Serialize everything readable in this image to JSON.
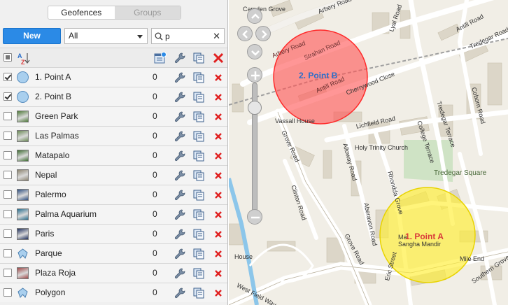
{
  "tabs": [
    {
      "label": "Geofences",
      "active": true
    },
    {
      "label": "Groups",
      "active": false
    }
  ],
  "toolbar": {
    "new_label": "New",
    "filter_value": "All",
    "search_value": "p",
    "clear_glyph": "✕"
  },
  "list_header": {
    "select_all_state": "partial",
    "sort_icon": "sort-az-icon",
    "icons": [
      "layer-settings-icon",
      "wrench-icon",
      "copy-icon",
      "delete-icon"
    ]
  },
  "geofences": [
    {
      "name": "1. Point A",
      "count": "0",
      "checked": true,
      "icon": "circle-icon",
      "thumb": ""
    },
    {
      "name": "2. Point B",
      "count": "0",
      "checked": true,
      "icon": "circle-icon",
      "thumb": ""
    },
    {
      "name": "Green Park",
      "count": "0",
      "checked": false,
      "icon": "photo-icon",
      "thumb": "#4f7a3a"
    },
    {
      "name": "Las Palmas",
      "count": "0",
      "checked": false,
      "icon": "photo-icon",
      "thumb": "#6b8a55"
    },
    {
      "name": "Matapalo",
      "count": "0",
      "checked": false,
      "icon": "photo-icon",
      "thumb": "#3f6d33"
    },
    {
      "name": "Nepal",
      "count": "0",
      "checked": false,
      "icon": "photo-icon",
      "thumb": "#8c8470"
    },
    {
      "name": "Palermo",
      "count": "0",
      "checked": false,
      "icon": "photo-icon",
      "thumb": "#2f4f80"
    },
    {
      "name": "Palma Aquarium",
      "count": "0",
      "checked": false,
      "icon": "photo-icon",
      "thumb": "#2a6f8f"
    },
    {
      "name": "Paris",
      "count": "0",
      "checked": false,
      "icon": "photo-icon",
      "thumb": "#1f2f5c"
    },
    {
      "name": "Parque",
      "count": "0",
      "checked": false,
      "icon": "polygon-icon",
      "thumb": ""
    },
    {
      "name": "Plaza Roja",
      "count": "0",
      "checked": false,
      "icon": "photo-icon",
      "thumb": "#a04a4a"
    },
    {
      "name": "Polygon",
      "count": "0",
      "checked": false,
      "icon": "polygon-icon",
      "thumb": ""
    }
  ],
  "map": {
    "fences": [
      {
        "label": "1. Point A",
        "color": "#ffee33",
        "label_color": "#d93a3a"
      },
      {
        "label": "2. Point B",
        "color": "#ff5555",
        "label_color": "#2b6ec9"
      }
    ],
    "streets": [
      "Camden Grove",
      "Arbery Road",
      "Lyal Road",
      "Antill Road",
      "Tredegar Road",
      "Strahan Road",
      "Antill Road",
      "Arbery Road",
      "Cherrywood Close",
      "Vassall House",
      "Lichfield Road",
      "College Terrace",
      "Tredegar Terrace",
      "Coborn Road",
      "Grove Road",
      "Alloway Road",
      "Holy Trinity Church",
      "Tredegar Square",
      "Clinton Road",
      "Rhondda Grove",
      "Aberavon Road",
      "Grove Road",
      "Sangha Mandir",
      "Eric Street",
      "Southern Grove",
      "Mile End",
      "West Field Way",
      "House",
      "Ma"
    ]
  },
  "colors": {
    "accent": "#2b8ae6",
    "delete": "#e02020",
    "fence_a": "#ffee33",
    "fence_b": "#ff5555"
  }
}
